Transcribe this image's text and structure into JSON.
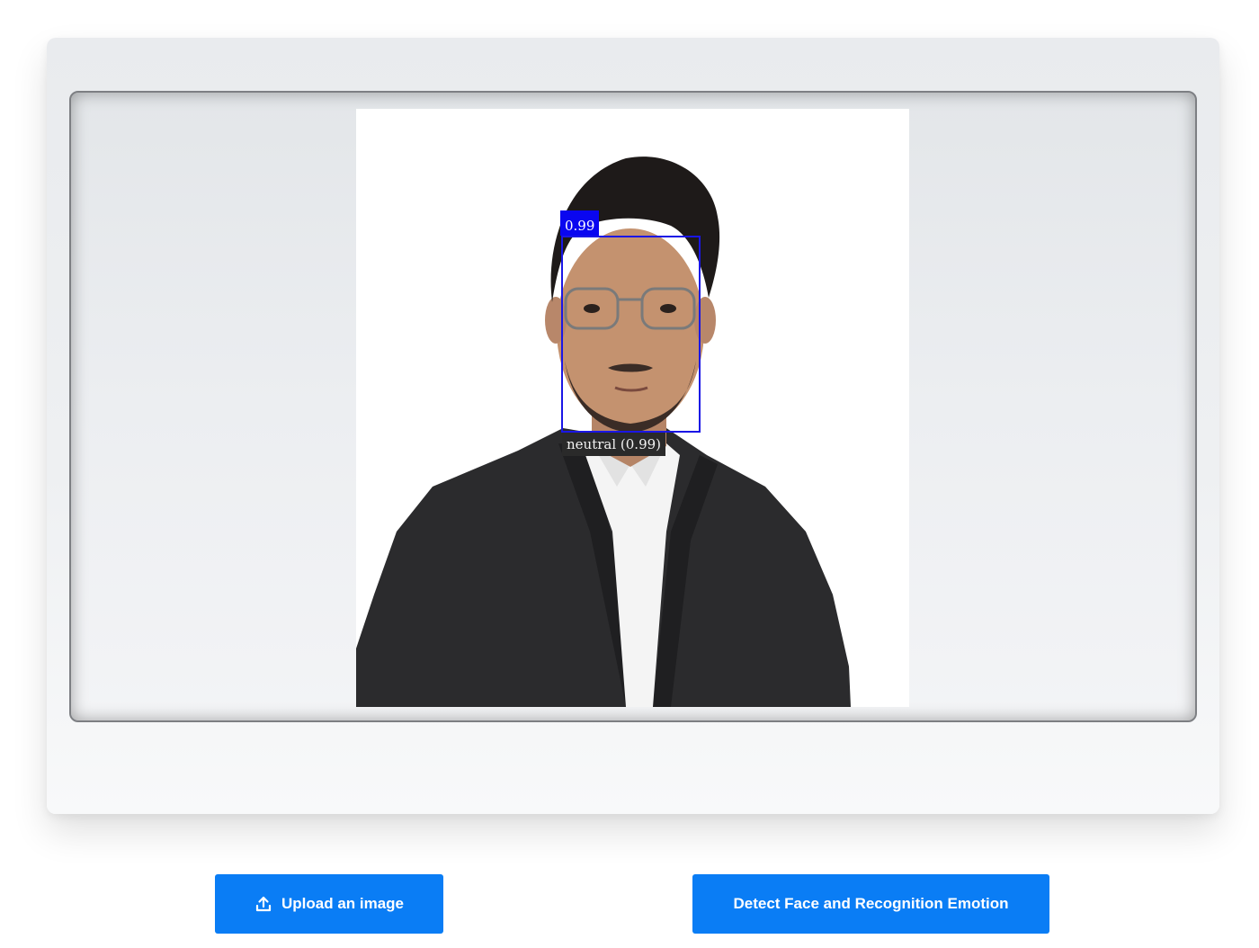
{
  "viewer": {
    "detection_score": "0.99",
    "emotion_label": "neutral (0.99)"
  },
  "actions": {
    "upload_label": "Upload an image",
    "upload_icon": "upload-icon",
    "detect_label": "Detect Face and Recognition Emotion"
  },
  "colors": {
    "button": "#0a7df5",
    "face_box": "#1a16e6",
    "score_label_bg": "#0a06f0",
    "emotion_label_bg": "#2a2a2a"
  }
}
